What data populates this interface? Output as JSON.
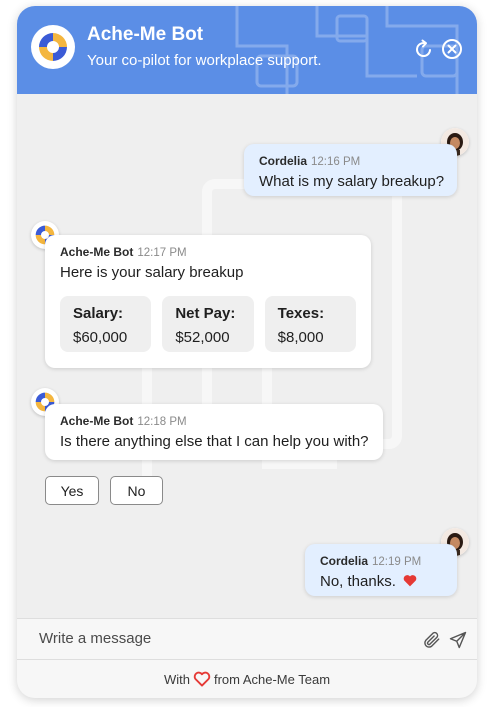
{
  "header": {
    "title": "Ache-Me Bot",
    "subtitle": "Your co-pilot for workplace support.",
    "color": "#5b8ee6"
  },
  "messages": [
    {
      "sender": "Cordelia",
      "time": "12:16 PM",
      "text": "What is my salary breakup?",
      "role": "user"
    },
    {
      "sender": "Ache-Me Bot",
      "time": "12:17 PM",
      "text": "Here is your salary breakup",
      "role": "bot",
      "cards": [
        {
          "label": "Salary:",
          "value": "$60,000"
        },
        {
          "label": "Net Pay:",
          "value": "$52,000"
        },
        {
          "label": "Texes:",
          "value": "$8,000"
        }
      ]
    },
    {
      "sender": "Ache-Me Bot",
      "time": "12:18 PM",
      "text": "Is there anything else that I can help you with?",
      "role": "bot"
    },
    {
      "sender": "Cordelia",
      "time": "12:19 PM",
      "text": "No, thanks.",
      "role": "user",
      "emoji": "heart"
    }
  ],
  "quick_replies": [
    "Yes",
    "No"
  ],
  "input": {
    "placeholder": "Write a message"
  },
  "footer": {
    "prefix": "With",
    "suffix": "from Ache-Me Team"
  },
  "icons": {
    "logo": "ache-me-logo",
    "refresh": "refresh-icon",
    "close": "close-circle-icon",
    "attach": "paperclip-icon",
    "send": "send-icon",
    "heart": "heart-icon"
  },
  "colors": {
    "user_bubble": "#e3efff",
    "bot_bubble": "#ffffff",
    "heart": "#e53935"
  }
}
